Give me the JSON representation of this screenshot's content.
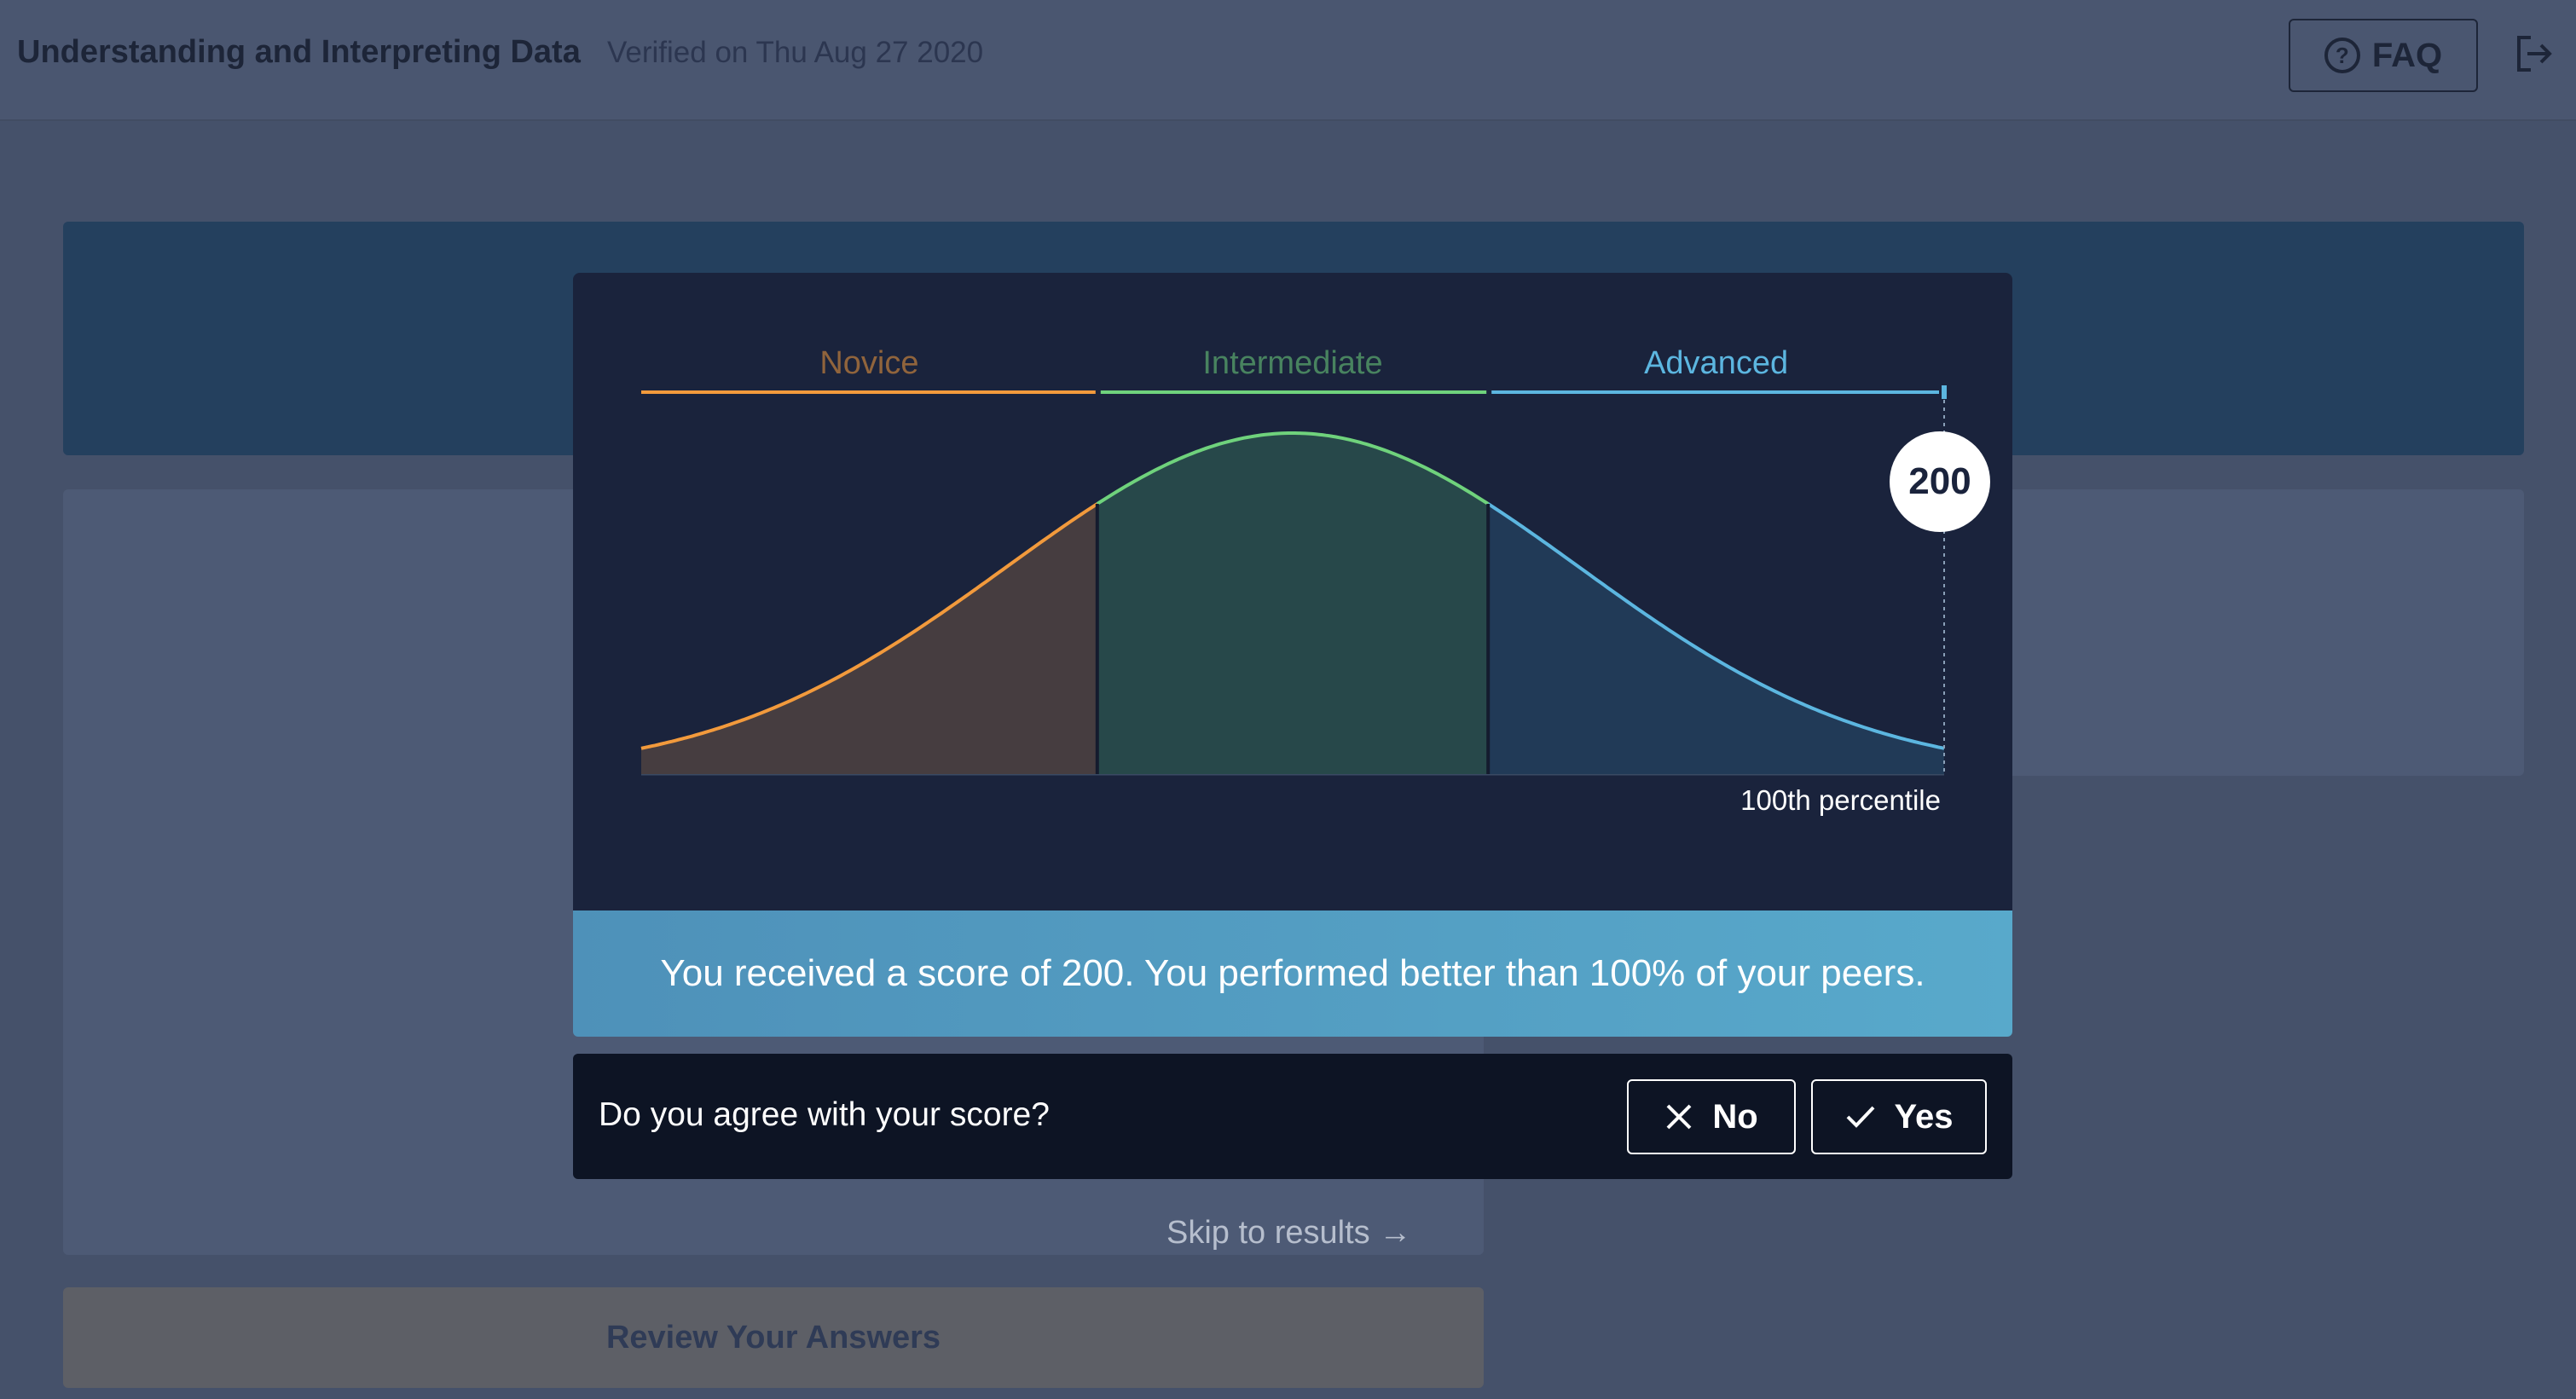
{
  "header": {
    "title": "Understanding and Interpreting Data",
    "verified": "Verified on Thu Aug 27 2020",
    "faq_label": "FAQ",
    "faq_icon": "help-circle-icon",
    "logout_icon": "logout-icon"
  },
  "background": {
    "skip_link": "Skip to results →",
    "review_button": "Review Your Answers"
  },
  "modal": {
    "chart_data": {
      "type": "area",
      "bands": [
        {
          "name": "Novice",
          "color": "#f29a3c"
        },
        {
          "name": "Intermediate",
          "color": "#6fd27c"
        },
        {
          "name": "Advanced",
          "color": "#5cb6e0"
        }
      ],
      "band_bounds_percentile": [
        0,
        35,
        65,
        100
      ],
      "marker": {
        "score": "200",
        "percentile": 100
      },
      "x_label": "100th percentile"
    },
    "result_text": "You received a score of 200. You performed better than 100% of your peers.",
    "question": "Do you agree with your score?",
    "no_label": "No",
    "yes_label": "Yes",
    "no_icon": "close-icon",
    "yes_icon": "check-icon"
  }
}
